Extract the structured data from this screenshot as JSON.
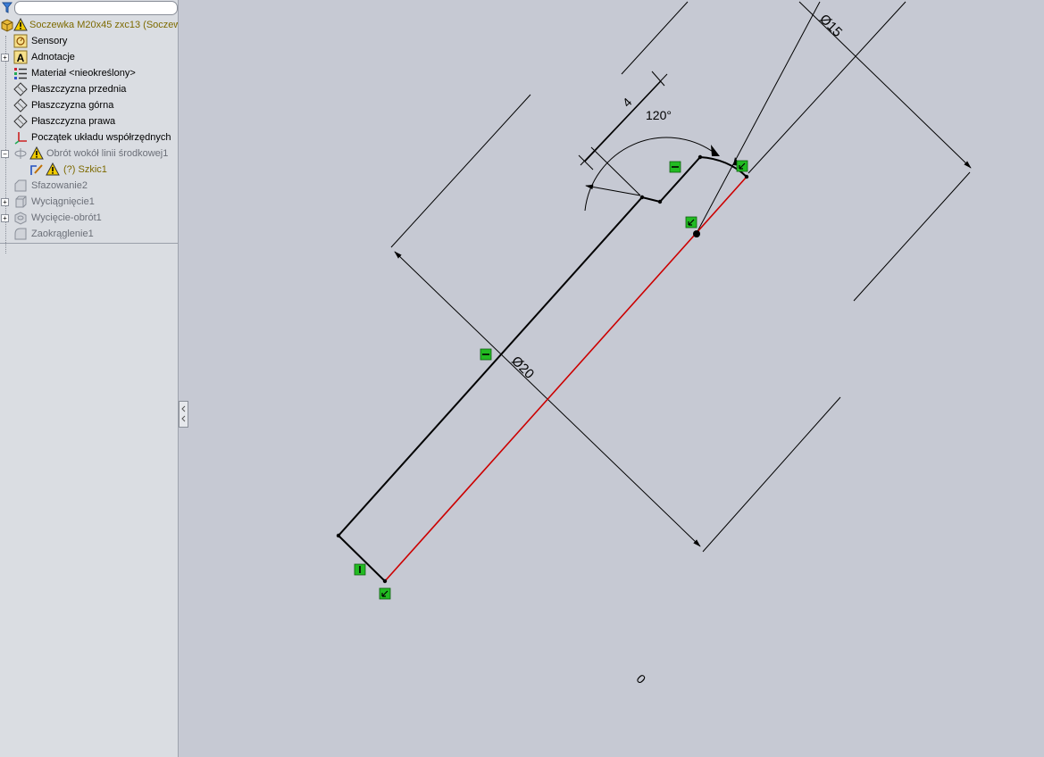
{
  "tree": {
    "root_label": "Soczewka M20x45 zxc13  (Soczew",
    "items": [
      {
        "label": "Sensory",
        "icon": "sensor-icon"
      },
      {
        "label": "Adnotacje",
        "icon": "annotation-icon"
      },
      {
        "label": "Materiał <nieokreślony>",
        "icon": "material-icon"
      },
      {
        "label": "Płaszczyzna przednia",
        "icon": "plane-icon"
      },
      {
        "label": "Płaszczyzna górna",
        "icon": "plane-icon"
      },
      {
        "label": "Płaszczyzna prawa",
        "icon": "plane-icon"
      },
      {
        "label": "Początek układu współrzędnych",
        "icon": "origin-icon"
      },
      {
        "label": "Obrót wokół linii środkowej1",
        "icon": "revolve-icon"
      },
      {
        "label": "(?) Szkic1",
        "icon": "sketch-icon"
      },
      {
        "label": "Sfazowanie2",
        "icon": "chamfer-icon"
      },
      {
        "label": "Wyciągnięcie1",
        "icon": "extrude-icon"
      },
      {
        "label": "Wycięcie-obrót1",
        "icon": "revolve-cut-icon"
      },
      {
        "label": "Zaokrąglenie1",
        "icon": "fillet-icon"
      }
    ]
  },
  "sketch": {
    "dim_length": "4",
    "dim_angle": "120°",
    "dim_dia_small": "Ø15",
    "dim_dia_large": "Ø20",
    "origin_label": "0"
  },
  "colors": {
    "background": "#c6c9d3",
    "sketch_line": "#000000",
    "centerline": "#cc0000",
    "relation": "#22bb22",
    "warning": "#f2cc00"
  }
}
